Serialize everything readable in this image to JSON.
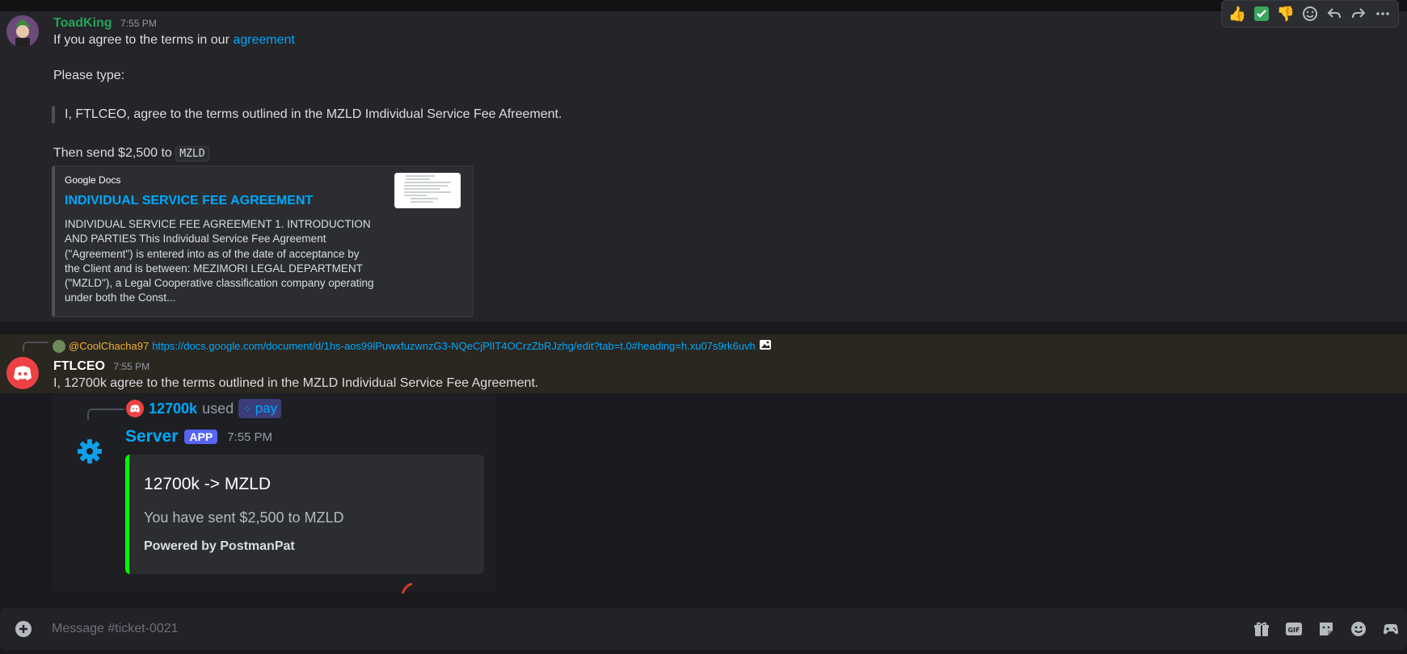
{
  "colors": {
    "link": "#00a8fc",
    "toad_name": "#23a559",
    "coolchacha": "#f0b132",
    "success_bar": "#00ff00"
  },
  "toolbar": {
    "icons": [
      "thumbs-up-icon",
      "check-icon",
      "thumbs-down-icon",
      "add-reaction-icon",
      "reply-icon",
      "forward-icon",
      "more-icon"
    ]
  },
  "msg1": {
    "author": "ToadKing",
    "time": "7:55 PM",
    "line1_prefix": "If you agree to the terms in our ",
    "line1_link": "agreement",
    "line2": "Please type:",
    "quote": "I, FTLCEO, agree to the terms outlined in the MZLD Imdividual Service Fee Afreement.",
    "line3_prefix": "Then send $2,500 to ",
    "line3_code": "MZLD",
    "embed": {
      "provider": "Google Docs",
      "title": "INDIVIDUAL SERVICE FEE AGREEMENT",
      "description": "INDIVIDUAL SERVICE FEE AGREEMENT 1. INTRODUCTION AND PARTIES This Individual Service Fee Agreement (\"Agreement\") is entered into as of the date of acceptance by the Client and is between: MEZIMORI LEGAL DEPARTMENT (\"MZLD\"), a Legal Cooperative classification company operating under both the Const..."
    }
  },
  "msg2": {
    "reply_user": "@CoolChacha97",
    "reply_link": "https://docs.google.com/document/d/1hs-aos99lPuwxfuzwnzG3-NQeCjPlIT4OCrzZbRJzhg/edit?tab=t.0#heading=h.xu07s9rk6uvh",
    "author": "FTLCEO",
    "time": "7:55 PM",
    "text": "I, 12700k agree to the terms outlined in the MZLD Individual Service Fee Agreement."
  },
  "msg3": {
    "reply_user": "12700k",
    "reply_used": "used",
    "reply_command": "pay",
    "author": "Server",
    "badge": "APP",
    "time": "7:55 PM",
    "embed": {
      "title": "12700k -> MZLD",
      "description": "You have sent $2,500 to MZLD",
      "footer": "Powered by PostmanPat"
    }
  },
  "input": {
    "placeholder": "Message #ticket-0021",
    "icons": [
      "gift-icon",
      "gif-icon",
      "sticker-icon",
      "emoji-icon",
      "apps-icon"
    ]
  }
}
